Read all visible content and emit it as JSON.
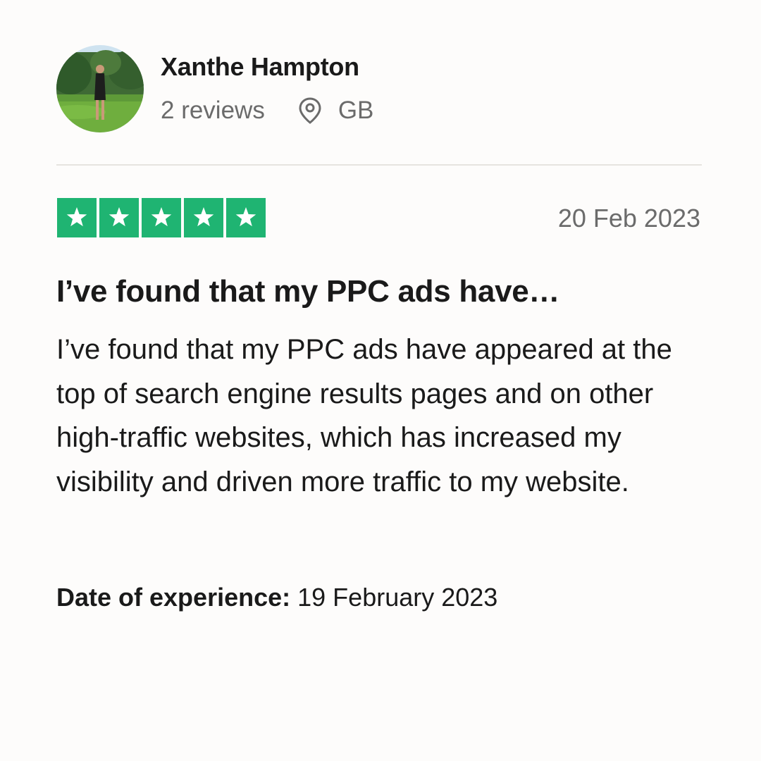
{
  "reviewer": {
    "name": "Xanthe Hampton",
    "review_count": "2 reviews",
    "country": "GB",
    "avatar_icon": "profile-photo-woman-in-garden",
    "location_icon": "location-pin-icon"
  },
  "review": {
    "rating": 5,
    "rating_max": 5,
    "star_color": "#1fb472",
    "date": "20 Feb 2023",
    "title": "I’ve found that my PPC ads have…",
    "body": "I’ve found that my PPC ads have appeared at the top of search engine results pages and on other high-traffic websites, which has increased my visibility and driven more traffic to my website.",
    "experience_label": "Date of experience:",
    "experience_date": "19 February 2023"
  }
}
